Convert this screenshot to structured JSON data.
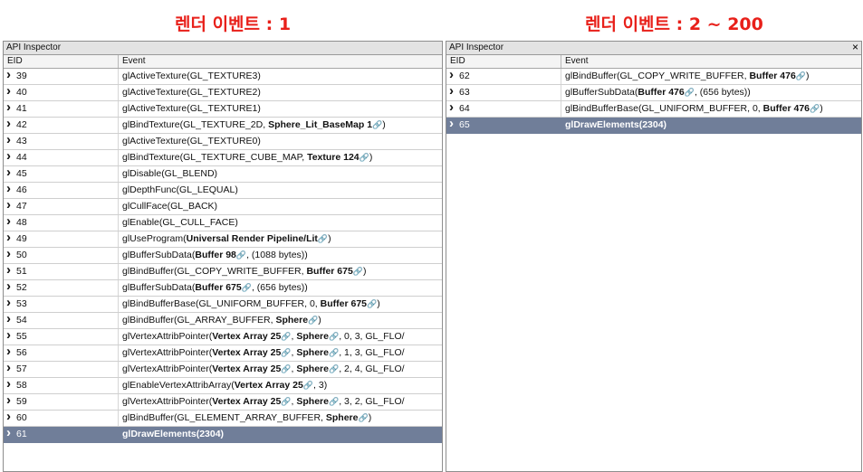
{
  "captions": {
    "left": "렌더 이벤트 : 1",
    "right": "렌더 이벤트 : 2 ~ 200"
  },
  "panels": [
    {
      "title": "API Inspector",
      "close": "×",
      "columns": [
        "EID",
        "Event"
      ],
      "selected_eid": "61",
      "rows": [
        {
          "eid": "39",
          "event": [
            {
              "t": "glActiveTexture(GL_TEXTURE3)"
            }
          ]
        },
        {
          "eid": "40",
          "event": [
            {
              "t": "glActiveTexture(GL_TEXTURE2)"
            }
          ]
        },
        {
          "eid": "41",
          "event": [
            {
              "t": "glActiveTexture(GL_TEXTURE1)"
            }
          ]
        },
        {
          "eid": "42",
          "event": [
            {
              "t": "glBindTexture(GL_TEXTURE_2D, "
            },
            {
              "b": "Sphere_Lit_BaseMap 1"
            },
            {
              "l": 1
            },
            {
              "t": ")"
            }
          ]
        },
        {
          "eid": "43",
          "event": [
            {
              "t": "glActiveTexture(GL_TEXTURE0)"
            }
          ]
        },
        {
          "eid": "44",
          "event": [
            {
              "t": "glBindTexture(GL_TEXTURE_CUBE_MAP, "
            },
            {
              "b": "Texture 124"
            },
            {
              "l": 1
            },
            {
              "t": ")"
            }
          ]
        },
        {
          "eid": "45",
          "event": [
            {
              "t": "glDisable(GL_BLEND)"
            }
          ]
        },
        {
          "eid": "46",
          "event": [
            {
              "t": "glDepthFunc(GL_LEQUAL)"
            }
          ]
        },
        {
          "eid": "47",
          "event": [
            {
              "t": "glCullFace(GL_BACK)"
            }
          ]
        },
        {
          "eid": "48",
          "event": [
            {
              "t": "glEnable(GL_CULL_FACE)"
            }
          ]
        },
        {
          "eid": "49",
          "event": [
            {
              "t": "glUseProgram("
            },
            {
              "b": "Universal Render Pipeline/Lit"
            },
            {
              "l": 1
            },
            {
              "t": ")"
            }
          ]
        },
        {
          "eid": "50",
          "event": [
            {
              "t": "glBufferSubData("
            },
            {
              "b": "Buffer 98"
            },
            {
              "l": 1
            },
            {
              "t": ", (1088 bytes))"
            }
          ]
        },
        {
          "eid": "51",
          "event": [
            {
              "t": "glBindBuffer(GL_COPY_WRITE_BUFFER, "
            },
            {
              "b": "Buffer 675"
            },
            {
              "l": 1
            },
            {
              "t": ")"
            }
          ]
        },
        {
          "eid": "52",
          "event": [
            {
              "t": "glBufferSubData("
            },
            {
              "b": "Buffer 675"
            },
            {
              "l": 1
            },
            {
              "t": ", (656 bytes))"
            }
          ]
        },
        {
          "eid": "53",
          "event": [
            {
              "t": "glBindBufferBase(GL_UNIFORM_BUFFER, 0, "
            },
            {
              "b": "Buffer 675"
            },
            {
              "l": 1
            },
            {
              "t": ")"
            }
          ]
        },
        {
          "eid": "54",
          "event": [
            {
              "t": "glBindBuffer(GL_ARRAY_BUFFER, "
            },
            {
              "b": "Sphere"
            },
            {
              "l": 1
            },
            {
              "t": ")"
            }
          ]
        },
        {
          "eid": "55",
          "event": [
            {
              "t": "glVertexAttribPointer("
            },
            {
              "b": "Vertex Array 25"
            },
            {
              "l": 1
            },
            {
              "t": ", "
            },
            {
              "b": "Sphere"
            },
            {
              "l": 1
            },
            {
              "t": ", 0, 3, GL_FLO/"
            }
          ]
        },
        {
          "eid": "56",
          "event": [
            {
              "t": "glVertexAttribPointer("
            },
            {
              "b": "Vertex Array 25"
            },
            {
              "l": 1
            },
            {
              "t": ", "
            },
            {
              "b": "Sphere"
            },
            {
              "l": 1
            },
            {
              "t": ", 1, 3, GL_FLO/"
            }
          ]
        },
        {
          "eid": "57",
          "event": [
            {
              "t": "glVertexAttribPointer("
            },
            {
              "b": "Vertex Array 25"
            },
            {
              "l": 1
            },
            {
              "t": ", "
            },
            {
              "b": "Sphere"
            },
            {
              "l": 1
            },
            {
              "t": ", 2, 4, GL_FLO/"
            }
          ]
        },
        {
          "eid": "58",
          "event": [
            {
              "t": "glEnableVertexAttribArray("
            },
            {
              "b": "Vertex Array 25"
            },
            {
              "l": 1
            },
            {
              "t": ", 3)"
            }
          ]
        },
        {
          "eid": "59",
          "event": [
            {
              "t": "glVertexAttribPointer("
            },
            {
              "b": "Vertex Array 25"
            },
            {
              "l": 1
            },
            {
              "t": ", "
            },
            {
              "b": "Sphere"
            },
            {
              "l": 1
            },
            {
              "t": ", 3, 2, GL_FLO/"
            }
          ]
        },
        {
          "eid": "60",
          "event": [
            {
              "t": "glBindBuffer(GL_ELEMENT_ARRAY_BUFFER, "
            },
            {
              "b": "Sphere"
            },
            {
              "l": 1
            },
            {
              "t": ")"
            }
          ]
        },
        {
          "eid": "61",
          "event": [
            {
              "t": "glDrawElements(2304)"
            }
          ]
        }
      ]
    },
    {
      "title": "API Inspector",
      "close": "×",
      "columns": [
        "EID",
        "Event"
      ],
      "selected_eid": "65",
      "rows": [
        {
          "eid": "62",
          "event": [
            {
              "t": "glBindBuffer(GL_COPY_WRITE_BUFFER, "
            },
            {
              "b": "Buffer 476"
            },
            {
              "l": 1
            },
            {
              "t": ")"
            }
          ]
        },
        {
          "eid": "63",
          "event": [
            {
              "t": "glBufferSubData("
            },
            {
              "b": "Buffer 476"
            },
            {
              "l": 1
            },
            {
              "t": ", (656 bytes))"
            }
          ]
        },
        {
          "eid": "64",
          "event": [
            {
              "t": "glBindBufferBase(GL_UNIFORM_BUFFER, 0, "
            },
            {
              "b": "Buffer 476"
            },
            {
              "l": 1
            },
            {
              "t": ")"
            }
          ]
        },
        {
          "eid": "65",
          "event": [
            {
              "t": "glDrawElements(2304)"
            }
          ]
        }
      ]
    }
  ],
  "icons": {
    "row_expand": "chevron-right-icon",
    "resource_link": "link-icon"
  },
  "colors": {
    "caption": "#e8201a",
    "selected_row": "#707e99",
    "titlebar": "#e3e3e3"
  }
}
